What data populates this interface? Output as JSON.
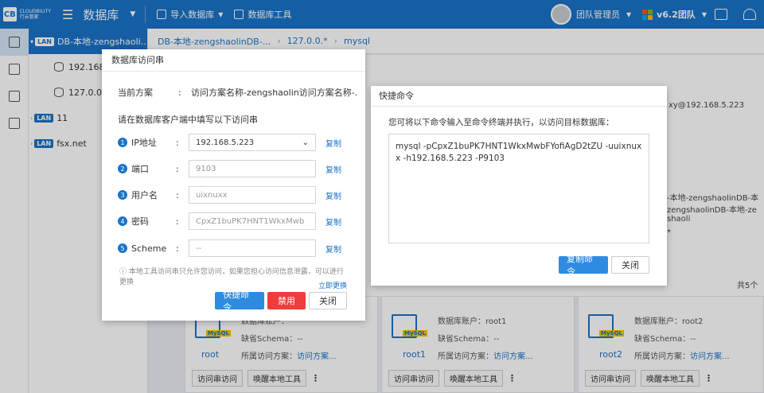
{
  "topbar": {
    "logo_mark": "CB",
    "logo_text_en": "CLOUDBILITY",
    "logo_text_cn": "行云管家",
    "app_title": "数据库",
    "import_label": "导入数据库",
    "tools_label": "数据库工具",
    "user_label": "团队管理员",
    "version_label": "v6.2团队"
  },
  "tree": {
    "nodes": [
      {
        "tag": "LAN",
        "label": "DB-本地-zengshaoli..."
      },
      {
        "label": "192.168."
      },
      {
        "label": "127.0.0."
      },
      {
        "tag": "LAN",
        "label": "11"
      },
      {
        "tag": "LAN",
        "label": "fsx.net"
      }
    ]
  },
  "breadcrumb": {
    "items": [
      "DB-本地-zengshaolinDB-...",
      "127.0.0.*",
      "mysql"
    ]
  },
  "background": {
    "proxy_text": "xy@192.168.5.223",
    "name_line1": "-本地-zengshaolinDB-本",
    "name_line2": "zengshaolinDB-本地-ze",
    "name_line3": "shaoli",
    "name_line4": "*",
    "count_text": "共5个"
  },
  "cards": [
    {
      "name": "root",
      "account_label": "数据库账户",
      "account_value": "",
      "schema_label": "缺省Schema",
      "schema_value": "--",
      "plan_label": "所属访问方案",
      "plan_value": "访问方案...",
      "btn1": "访问串访问",
      "btn2": "唤醒本地工具"
    },
    {
      "name": "root1",
      "account_label": "数据库账户",
      "account_value": "root1",
      "schema_label": "缺省Schema",
      "schema_value": "--",
      "plan_label": "所属访问方案",
      "plan_value": "访问方案...",
      "btn1": "访问串访问",
      "btn2": "唤醒本地工具"
    },
    {
      "name": "root2",
      "account_label": "数据库账户",
      "account_value": "root2",
      "schema_label": "缺省Schema",
      "schema_value": "--",
      "plan_label": "所属访问方案",
      "plan_value": "访问方案...",
      "btn1": "访问串访问",
      "btn2": "唤醒本地工具"
    }
  ],
  "dialog_access": {
    "title": "数据库访问串",
    "plan_label": "当前方案",
    "plan_value": "访问方案名称-zengshaolin访问方案名称-...",
    "instruction": "请在数据库客户端中填写以下访问串",
    "fields": [
      {
        "num": "1",
        "label": "IP地址",
        "value": "192.168.5.223",
        "copy": "复制"
      },
      {
        "num": "2",
        "label": "端口",
        "value": "9103",
        "copy": "复制"
      },
      {
        "num": "3",
        "label": "用户名",
        "value": "uixnuxx",
        "copy": "复制"
      },
      {
        "num": "4",
        "label": "密码",
        "value": "CpxZ1buPK7HNT1WkxMwb",
        "copy": "复制"
      },
      {
        "num": "5",
        "label": "Scheme",
        "value": "--",
        "copy": "复制"
      }
    ],
    "notice": "本地工具访问串只允许您访问，如果您担心访问信息泄露，可以进行更换",
    "change_now": "立即更换",
    "btn_quick": "快捷命令",
    "btn_disable": "禁用",
    "btn_close": "关闭"
  },
  "dialog_cmd": {
    "title": "快捷命令",
    "instruction": "您可将以下命令输入至命令终端并执行，以访问目标数据库：",
    "command": "mysql -pCpxZ1buPK7HNT1WkxMwbFYofiAgD2tZU  -uuixnuxx -h192.168.5.223 -P9103",
    "btn_copy": "复制命令",
    "btn_close": "关闭"
  },
  "colors": {
    "primary": "#1a73c7",
    "danger": "#f03c3c"
  }
}
